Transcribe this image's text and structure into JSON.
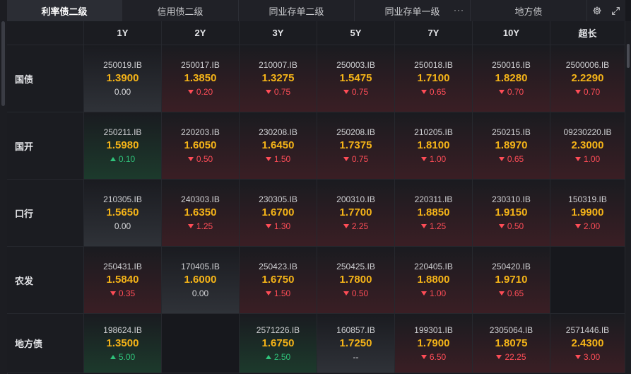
{
  "tabs": [
    {
      "label": "利率债二级",
      "active": true
    },
    {
      "label": "信用债二级",
      "active": false
    },
    {
      "label": "同业存单二级",
      "active": false
    },
    {
      "label": "同业存单一级",
      "active": false
    },
    {
      "label": "地方债",
      "active": false
    }
  ],
  "tab_more": "···",
  "columns": [
    "1Y",
    "2Y",
    "3Y",
    "5Y",
    "7Y",
    "10Y",
    "超长"
  ],
  "rows": [
    {
      "label": "国债",
      "cells": [
        {
          "code": "250019.IB",
          "rate": "1.3900",
          "change": "0.00",
          "dir": "flat"
        },
        {
          "code": "250017.IB",
          "rate": "1.3850",
          "change": "0.20",
          "dir": "down"
        },
        {
          "code": "210007.IB",
          "rate": "1.3275",
          "change": "0.75",
          "dir": "down"
        },
        {
          "code": "250003.IB",
          "rate": "1.5475",
          "change": "0.75",
          "dir": "down"
        },
        {
          "code": "250018.IB",
          "rate": "1.7100",
          "change": "0.65",
          "dir": "down"
        },
        {
          "code": "250016.IB",
          "rate": "1.8280",
          "change": "0.70",
          "dir": "down"
        },
        {
          "code": "2500006.IB",
          "rate": "2.2290",
          "change": "0.70",
          "dir": "down"
        }
      ]
    },
    {
      "label": "国开",
      "cells": [
        {
          "code": "250211.IB",
          "rate": "1.5980",
          "change": "0.10",
          "dir": "up"
        },
        {
          "code": "220203.IB",
          "rate": "1.6050",
          "change": "0.50",
          "dir": "down"
        },
        {
          "code": "230208.IB",
          "rate": "1.6450",
          "change": "1.50",
          "dir": "down"
        },
        {
          "code": "250208.IB",
          "rate": "1.7375",
          "change": "0.75",
          "dir": "down"
        },
        {
          "code": "210205.IB",
          "rate": "1.8100",
          "change": "1.00",
          "dir": "down"
        },
        {
          "code": "250215.IB",
          "rate": "1.8970",
          "change": "0.65",
          "dir": "down"
        },
        {
          "code": "09230220.IB",
          "rate": "2.3000",
          "change": "1.00",
          "dir": "down"
        }
      ]
    },
    {
      "label": "口行",
      "cells": [
        {
          "code": "210305.IB",
          "rate": "1.5650",
          "change": "0.00",
          "dir": "flat"
        },
        {
          "code": "240303.IB",
          "rate": "1.6350",
          "change": "1.25",
          "dir": "down"
        },
        {
          "code": "230305.IB",
          "rate": "1.6700",
          "change": "1.30",
          "dir": "down"
        },
        {
          "code": "200310.IB",
          "rate": "1.7700",
          "change": "2.25",
          "dir": "down"
        },
        {
          "code": "220311.IB",
          "rate": "1.8850",
          "change": "1.25",
          "dir": "down"
        },
        {
          "code": "230310.IB",
          "rate": "1.9150",
          "change": "0.50",
          "dir": "down"
        },
        {
          "code": "150319.IB",
          "rate": "1.9900",
          "change": "2.00",
          "dir": "down"
        }
      ]
    },
    {
      "label": "农发",
      "cells": [
        {
          "code": "250431.IB",
          "rate": "1.5840",
          "change": "0.35",
          "dir": "down"
        },
        {
          "code": "170405.IB",
          "rate": "1.6000",
          "change": "0.00",
          "dir": "flat"
        },
        {
          "code": "250423.IB",
          "rate": "1.6750",
          "change": "1.50",
          "dir": "down"
        },
        {
          "code": "250425.IB",
          "rate": "1.7800",
          "change": "0.50",
          "dir": "down"
        },
        {
          "code": "220405.IB",
          "rate": "1.8800",
          "change": "1.00",
          "dir": "down"
        },
        {
          "code": "250420.IB",
          "rate": "1.9710",
          "change": "0.65",
          "dir": "down"
        },
        null
      ]
    },
    {
      "label": "地方债",
      "cells": [
        {
          "code": "198624.IB",
          "rate": "1.3500",
          "change": "5.00",
          "dir": "up"
        },
        null,
        {
          "code": "2571226.IB",
          "rate": "1.6750",
          "change": "2.50",
          "dir": "up"
        },
        {
          "code": "160857.IB",
          "rate": "1.7250",
          "change": "--",
          "dir": "flat"
        },
        {
          "code": "199301.IB",
          "rate": "1.7900",
          "change": "6.50",
          "dir": "down"
        },
        {
          "code": "2305064.IB",
          "rate": "1.8075",
          "change": "22.25",
          "dir": "down"
        },
        {
          "code": "2571446.IB",
          "rate": "2.4300",
          "change": "3.00",
          "dir": "down"
        }
      ]
    }
  ],
  "colors": {
    "rate": "#f5b418",
    "down": "#ff4d57",
    "up": "#2fc27a"
  },
  "icons": {
    "settings": "gear-icon",
    "expand": "expand-icon"
  }
}
